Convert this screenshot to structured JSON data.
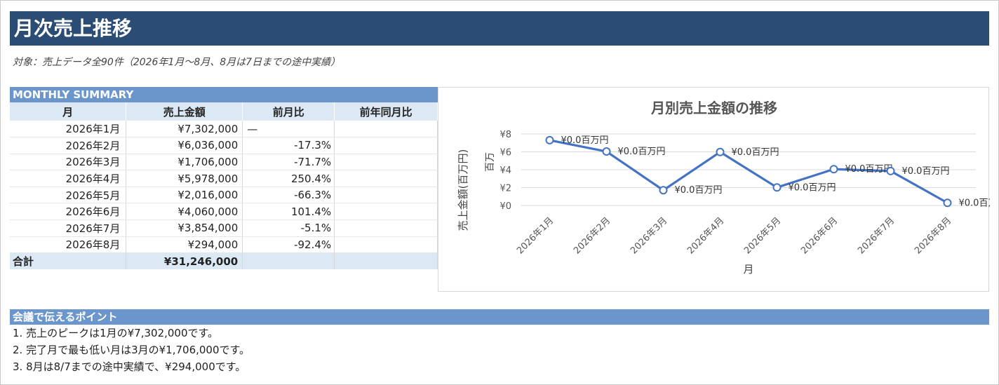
{
  "title": "月次売上推移",
  "subtitle": "対象：売上データ全90件（2026年1月～8月、8月は7日までの途中実績）",
  "summary": {
    "section_label": "MONTHLY SUMMARY",
    "headers": [
      "月",
      "売上金額",
      "前月比",
      "前年同月比"
    ],
    "rows": [
      {
        "month": "2026年1月",
        "sales": "¥7,302,000",
        "mom": "—",
        "yoy": ""
      },
      {
        "month": "2026年2月",
        "sales": "¥6,036,000",
        "mom": "-17.3%",
        "yoy": ""
      },
      {
        "month": "2026年3月",
        "sales": "¥1,706,000",
        "mom": "-71.7%",
        "yoy": ""
      },
      {
        "month": "2026年4月",
        "sales": "¥5,978,000",
        "mom": "250.4%",
        "yoy": ""
      },
      {
        "month": "2026年5月",
        "sales": "¥2,016,000",
        "mom": "-66.3%",
        "yoy": ""
      },
      {
        "month": "2026年6月",
        "sales": "¥4,060,000",
        "mom": "101.4%",
        "yoy": ""
      },
      {
        "month": "2026年7月",
        "sales": "¥3,854,000",
        "mom": "-5.1%",
        "yoy": ""
      },
      {
        "month": "2026年8月",
        "sales": "¥294,000",
        "mom": "-92.4%",
        "yoy": ""
      }
    ],
    "total_label": "合計",
    "total_value": "¥31,246,000"
  },
  "chart_data": {
    "type": "line",
    "title": "月別売上金額の推移",
    "xlabel": "月",
    "ylabel": "売上金額(百万円)",
    "unit_label": "百万",
    "categories": [
      "2026年1月",
      "2026年2月",
      "2026年3月",
      "2026年4月",
      "2026年5月",
      "2026年6月",
      "2026年7月",
      "2026年8月"
    ],
    "values": [
      7.302,
      6.036,
      1.706,
      5.978,
      2.016,
      4.06,
      3.854,
      0.294
    ],
    "data_labels": [
      "¥0.0百万円",
      "¥0.0百万円",
      "¥0.0百万円",
      "¥0.0百万円",
      "¥0.0百万円",
      "¥0.0百万円",
      "¥0.0百万円",
      "¥0.0百万円"
    ],
    "ylim": [
      0,
      8
    ],
    "yticks": [
      "¥0",
      "¥2",
      "¥4",
      "¥6",
      "¥8"
    ],
    "grid": true,
    "line_color": "#4472c4"
  },
  "points": {
    "section_label": "会議で伝えるポイント",
    "items": [
      "1. 売上のピークは1月の¥7,302,000です。",
      "2. 完了月で最も低い月は3月の¥1,706,000です。",
      "3. 8月は8/7までの途中実績で、¥294,000です。"
    ]
  },
  "colors": {
    "title_bg": "#2b4c74",
    "section_bg": "#6b96cc",
    "header_bg": "#dde8f5"
  }
}
